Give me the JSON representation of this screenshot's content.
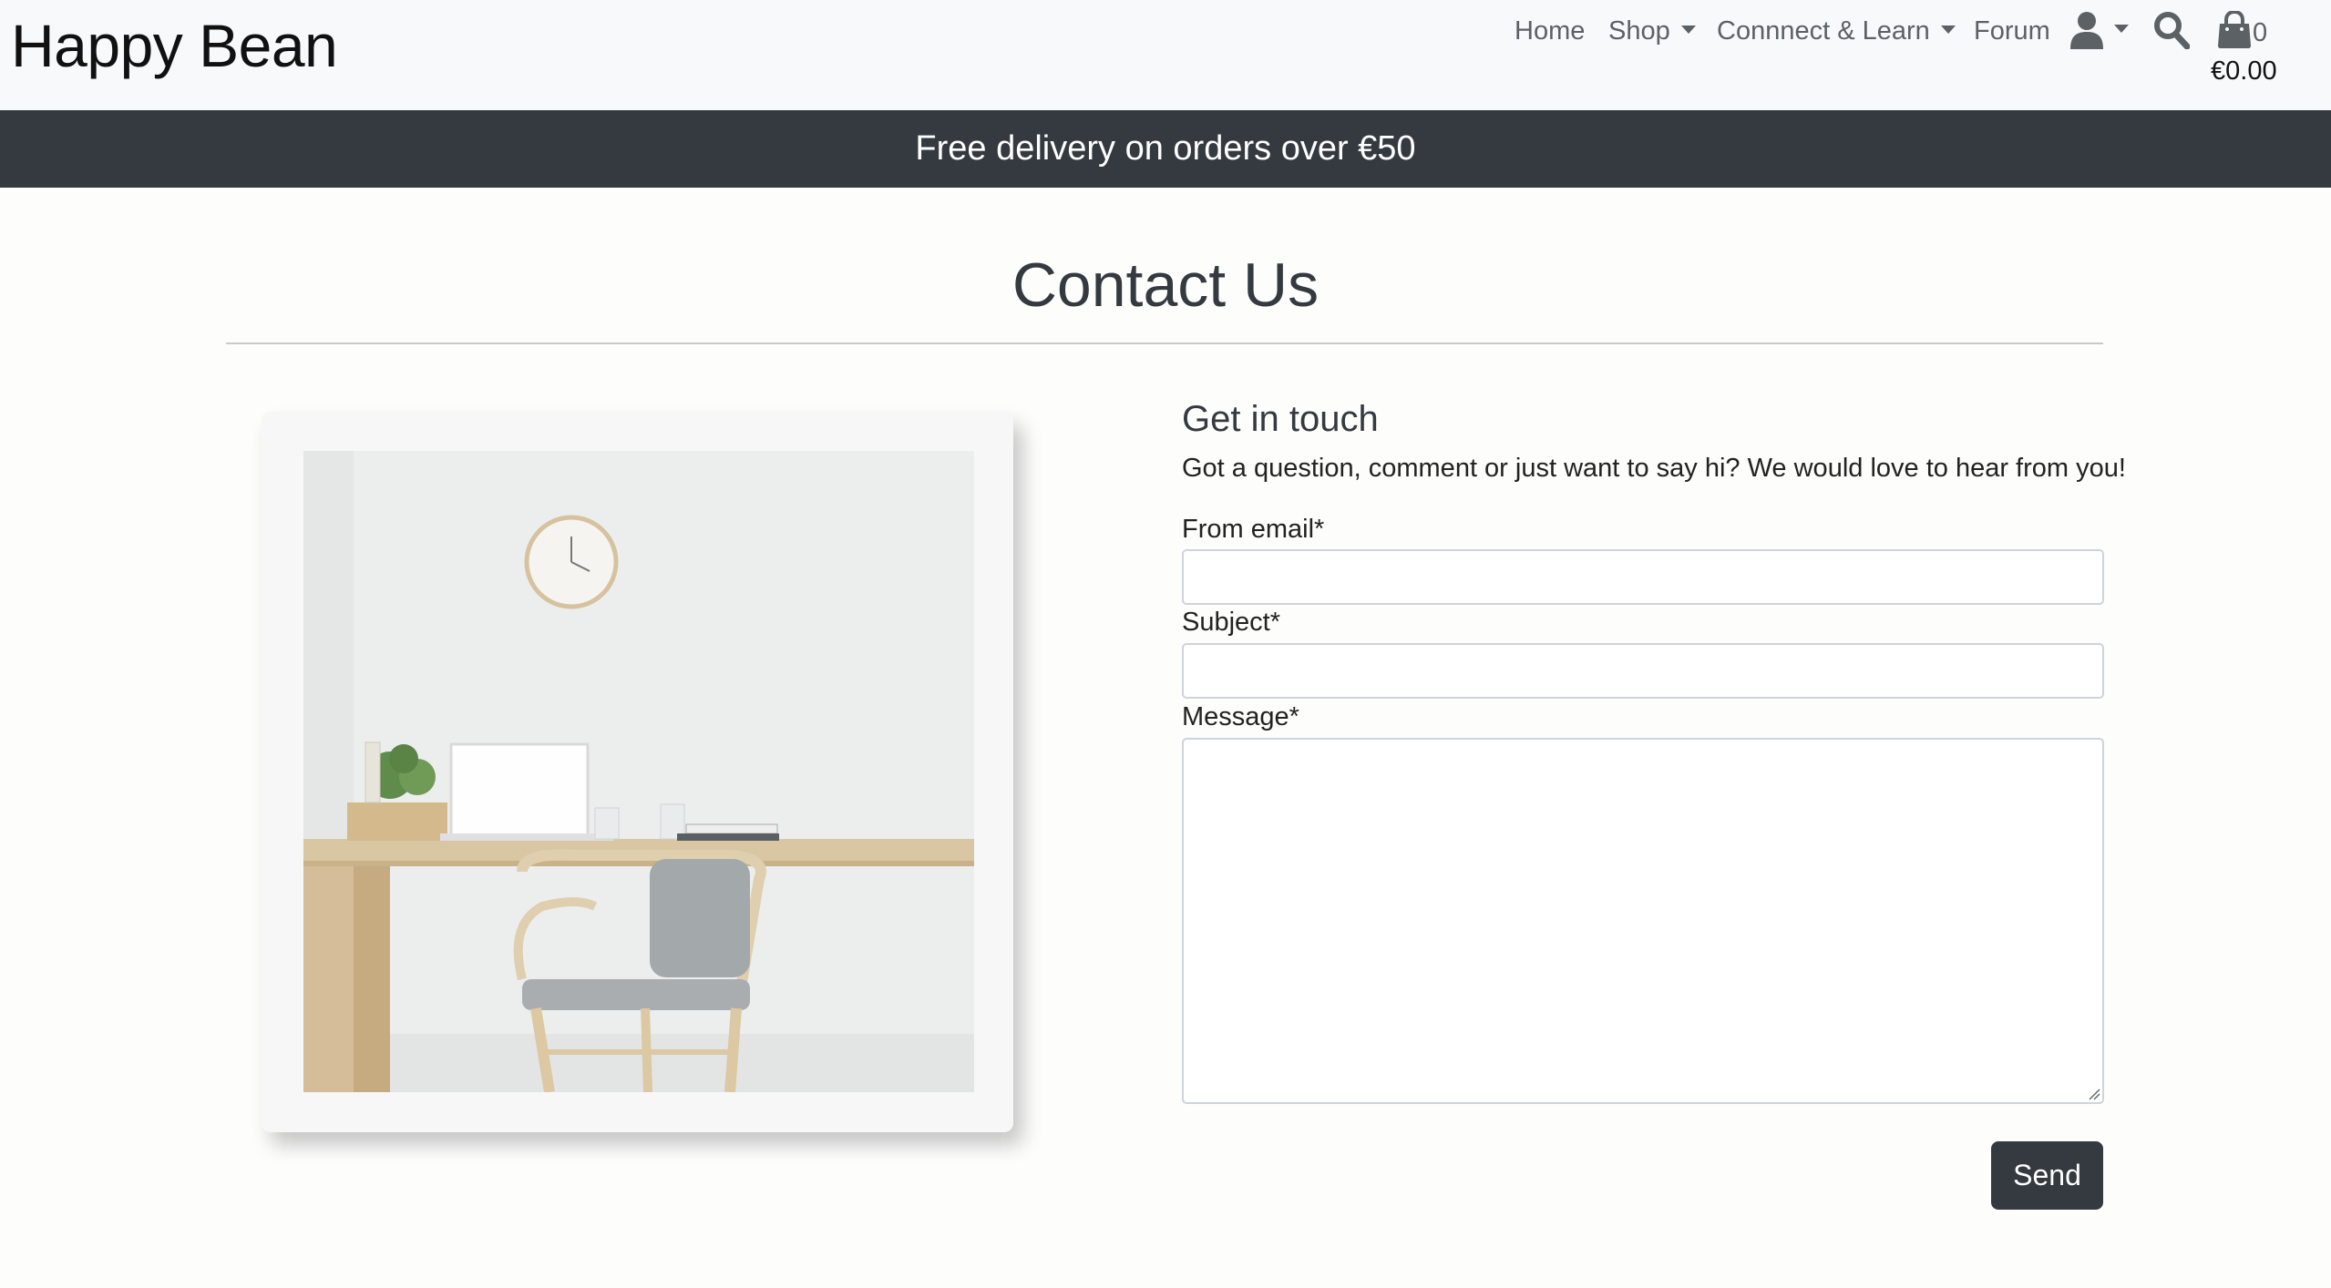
{
  "header": {
    "brand": "Happy Bean",
    "nav": {
      "home": "Home",
      "shop": "Shop",
      "connect_learn": "Connnect & Learn",
      "forum": "Forum"
    },
    "cart": {
      "count": "0",
      "total": "€0.00"
    }
  },
  "banner": {
    "text": "Free delivery on orders over €50"
  },
  "page": {
    "title": "Contact Us"
  },
  "contact_form": {
    "heading": "Get in touch",
    "intro": "Got a question, comment or just want to say hi? We would love to hear from you!",
    "email_label": "From email*",
    "email_value": "",
    "subject_label": "Subject*",
    "subject_value": "",
    "message_label": "Message*",
    "message_value": "",
    "send_label": "Send"
  },
  "colors": {
    "header_bg": "#f8f9fa",
    "banner_bg": "#343a40",
    "button_bg": "#343a40",
    "page_bg": "#fdfdfc"
  },
  "icons": [
    "user-icon",
    "search-icon",
    "shopping-bag-icon",
    "chevron-down-icon"
  ]
}
